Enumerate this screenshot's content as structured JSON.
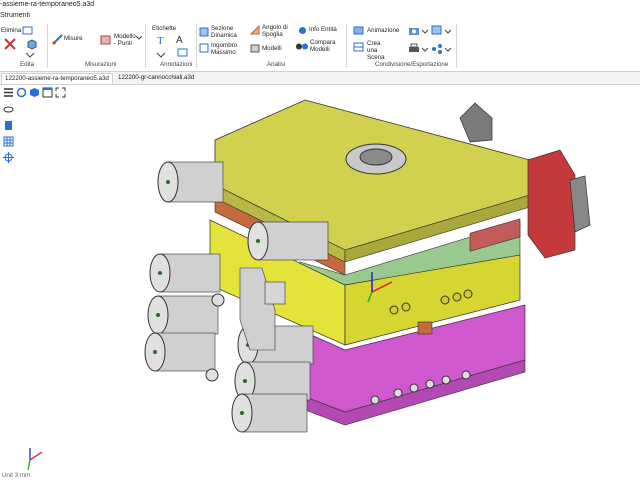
{
  "window": {
    "title": "-assieme-ra-temporaneo5.a3d"
  },
  "menu": {
    "strumenti": "Strumenti"
  },
  "ribbon": {
    "edita": {
      "elimina": "Elimina",
      "label": "Edita"
    },
    "misurazioni": {
      "misure": "Misure",
      "modello_punti": "Modello - Punti",
      "label": "Misurazioni"
    },
    "annotazioni": {
      "etichette": "Etichette",
      "label": "Annotazioni"
    },
    "analisi": {
      "sezione_dinamica": "Sezione Dinamica",
      "ingombro_massimo": "Ingombro Massimo",
      "angolo_di_spoglia": "Angolo di Spoglia",
      "modelli": "Modelli",
      "info_entita": "Info Entità",
      "compara_modelli": "Compara Modelli",
      "label": "Analisi"
    },
    "condivisione": {
      "animazione": "Animazione",
      "crea_una_scena": "Crea una Scena",
      "label": "Condivisione/Esportazione"
    }
  },
  "tabs": [
    {
      "label": "122200-assieme-ra-temporaneo5.a3d",
      "active": true
    },
    {
      "label": "122200-gr-cannocchiali.a3d",
      "active": false
    }
  ],
  "viewport": {
    "unit_label": "Unit 3 mm"
  },
  "colors": {
    "top_plate": "#d9d96a",
    "yellow_plate": "#e6e63c",
    "green_plate": "#8fc98f",
    "magenta_plate": "#cf58cf",
    "cylinder": "#cfcfcf",
    "orange_plate": "#c26a40",
    "red_block": "#c0393b"
  }
}
